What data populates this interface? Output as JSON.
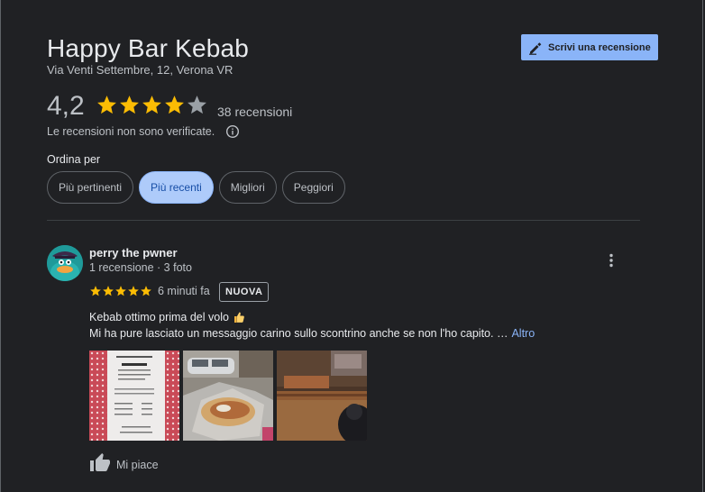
{
  "place": {
    "name": "Happy Bar Kebab",
    "address": "Via Venti Settembre, 12, Verona VR"
  },
  "actions": {
    "write_review_label": "Scrivi una recensione"
  },
  "summary": {
    "rating_text": "4,2",
    "rating_value": 4.2,
    "star_count": 5,
    "review_count_text": "38 recensioni",
    "disclaimer": "Le recensioni non sono verificate."
  },
  "sort": {
    "label": "Ordina per",
    "options": [
      {
        "label": "Più pertinenti",
        "selected": false
      },
      {
        "label": "Più recenti",
        "selected": true
      },
      {
        "label": "Migliori",
        "selected": false
      },
      {
        "label": "Peggiori",
        "selected": false
      }
    ]
  },
  "review": {
    "author": "perry the pwner",
    "meta": "1 recensione · 3 foto",
    "stars": 5,
    "time_ago": "6 minuti fa",
    "badge": "NUOVA",
    "text_line1": "Kebab ottimo prima del volo",
    "text_line2": "Mi ha pure lasciato un messaggio carino sullo scontrino anche se non l'ho capito. …",
    "more_label": "Altro",
    "photos": [
      "receipt-photo",
      "kebab-photo",
      "restaurant-interior-photo"
    ],
    "like_label": "Mi piace"
  },
  "colors": {
    "background": "#202124",
    "accent": "#8ab4f8",
    "star": "#fbbc04",
    "chip_selected_bg": "#aecbfa"
  }
}
